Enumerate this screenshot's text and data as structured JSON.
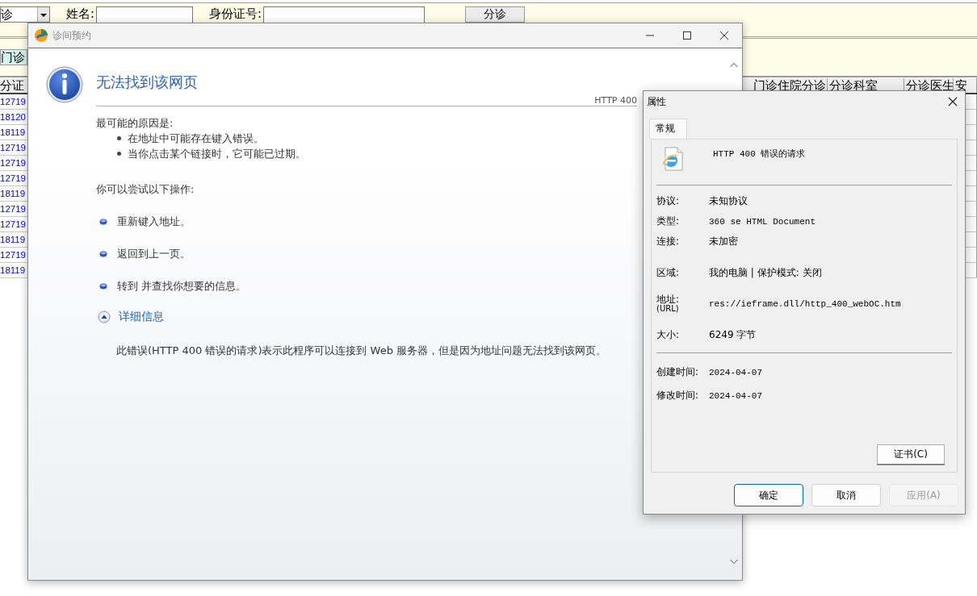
{
  "background_app": {
    "toolbar": {
      "dropdown": {
        "value": "诊"
      },
      "fields": [
        {
          "label": "姓名:"
        },
        {
          "label": "身份证号:"
        }
      ],
      "button": "分诊"
    },
    "tabs": [
      {
        "label": "门诊",
        "selected": true
      }
    ],
    "table": {
      "columns": [
        "分证",
        "门诊住院分诊",
        "分诊科室",
        "分诊医生",
        "安"
      ],
      "rows": [
        "12719",
        "18120",
        "18119",
        "12719",
        "12719",
        "12719",
        "18119",
        "12719",
        "12719",
        "18119",
        "12719",
        "18119"
      ]
    }
  },
  "error_window": {
    "title": "诊间预约",
    "heading": "无法找到该网页",
    "code": "HTTP 400",
    "causes_title": "最可能的原因是:",
    "causes": [
      "在地址中可能存在键入错误。",
      "当你点击某个链接时，它可能已过期。"
    ],
    "actions_title": "你可以尝试以下操作:",
    "actions": [
      "重新键入地址。",
      "返回到上一页。",
      "转到  并查找你想要的信息。"
    ],
    "details": {
      "label": "详细信息",
      "expanded": true
    },
    "details_text": "此错误(HTTP 400 错误的请求)表示此程序可以连接到 Web 服务器，但是因为地址问题无法找到该网页。"
  },
  "properties_dialog": {
    "title": "属性",
    "tabs": [
      {
        "label": "常规",
        "selected": true
      }
    ],
    "file_name": "HTTP 400 错误的请求",
    "sections": [
      [
        {
          "label": "协议:",
          "value": "未知协议",
          "kind": "text"
        },
        {
          "label": "类型:",
          "value": "360 se HTML Document",
          "kind": "mono"
        },
        {
          "label": "连接:",
          "value": "未加密",
          "kind": "text"
        }
      ],
      [
        {
          "label": "区域:",
          "value": "我的电脑 | 保护模式: 关闭",
          "kind": "text"
        },
        {
          "label": "地址:",
          "sublabel": "(URL)",
          "value": "res://ieframe.dll/http_400_webOC.htm",
          "kind": "mono"
        },
        {
          "label": "大小:",
          "value": "6249 字节",
          "kind": "text"
        }
      ],
      [
        {
          "label": "创建时间:",
          "value": "2024-04-07",
          "kind": "mono"
        },
        {
          "label": "修改时间:",
          "value": "2024-04-07",
          "kind": "mono"
        }
      ]
    ],
    "cert_button": "证书(C)",
    "buttons": [
      {
        "label": "确定",
        "default": true,
        "disabled": false
      },
      {
        "label": "取消",
        "default": false,
        "disabled": false
      },
      {
        "label": "应用(A)",
        "default": false,
        "disabled": true
      }
    ]
  }
}
